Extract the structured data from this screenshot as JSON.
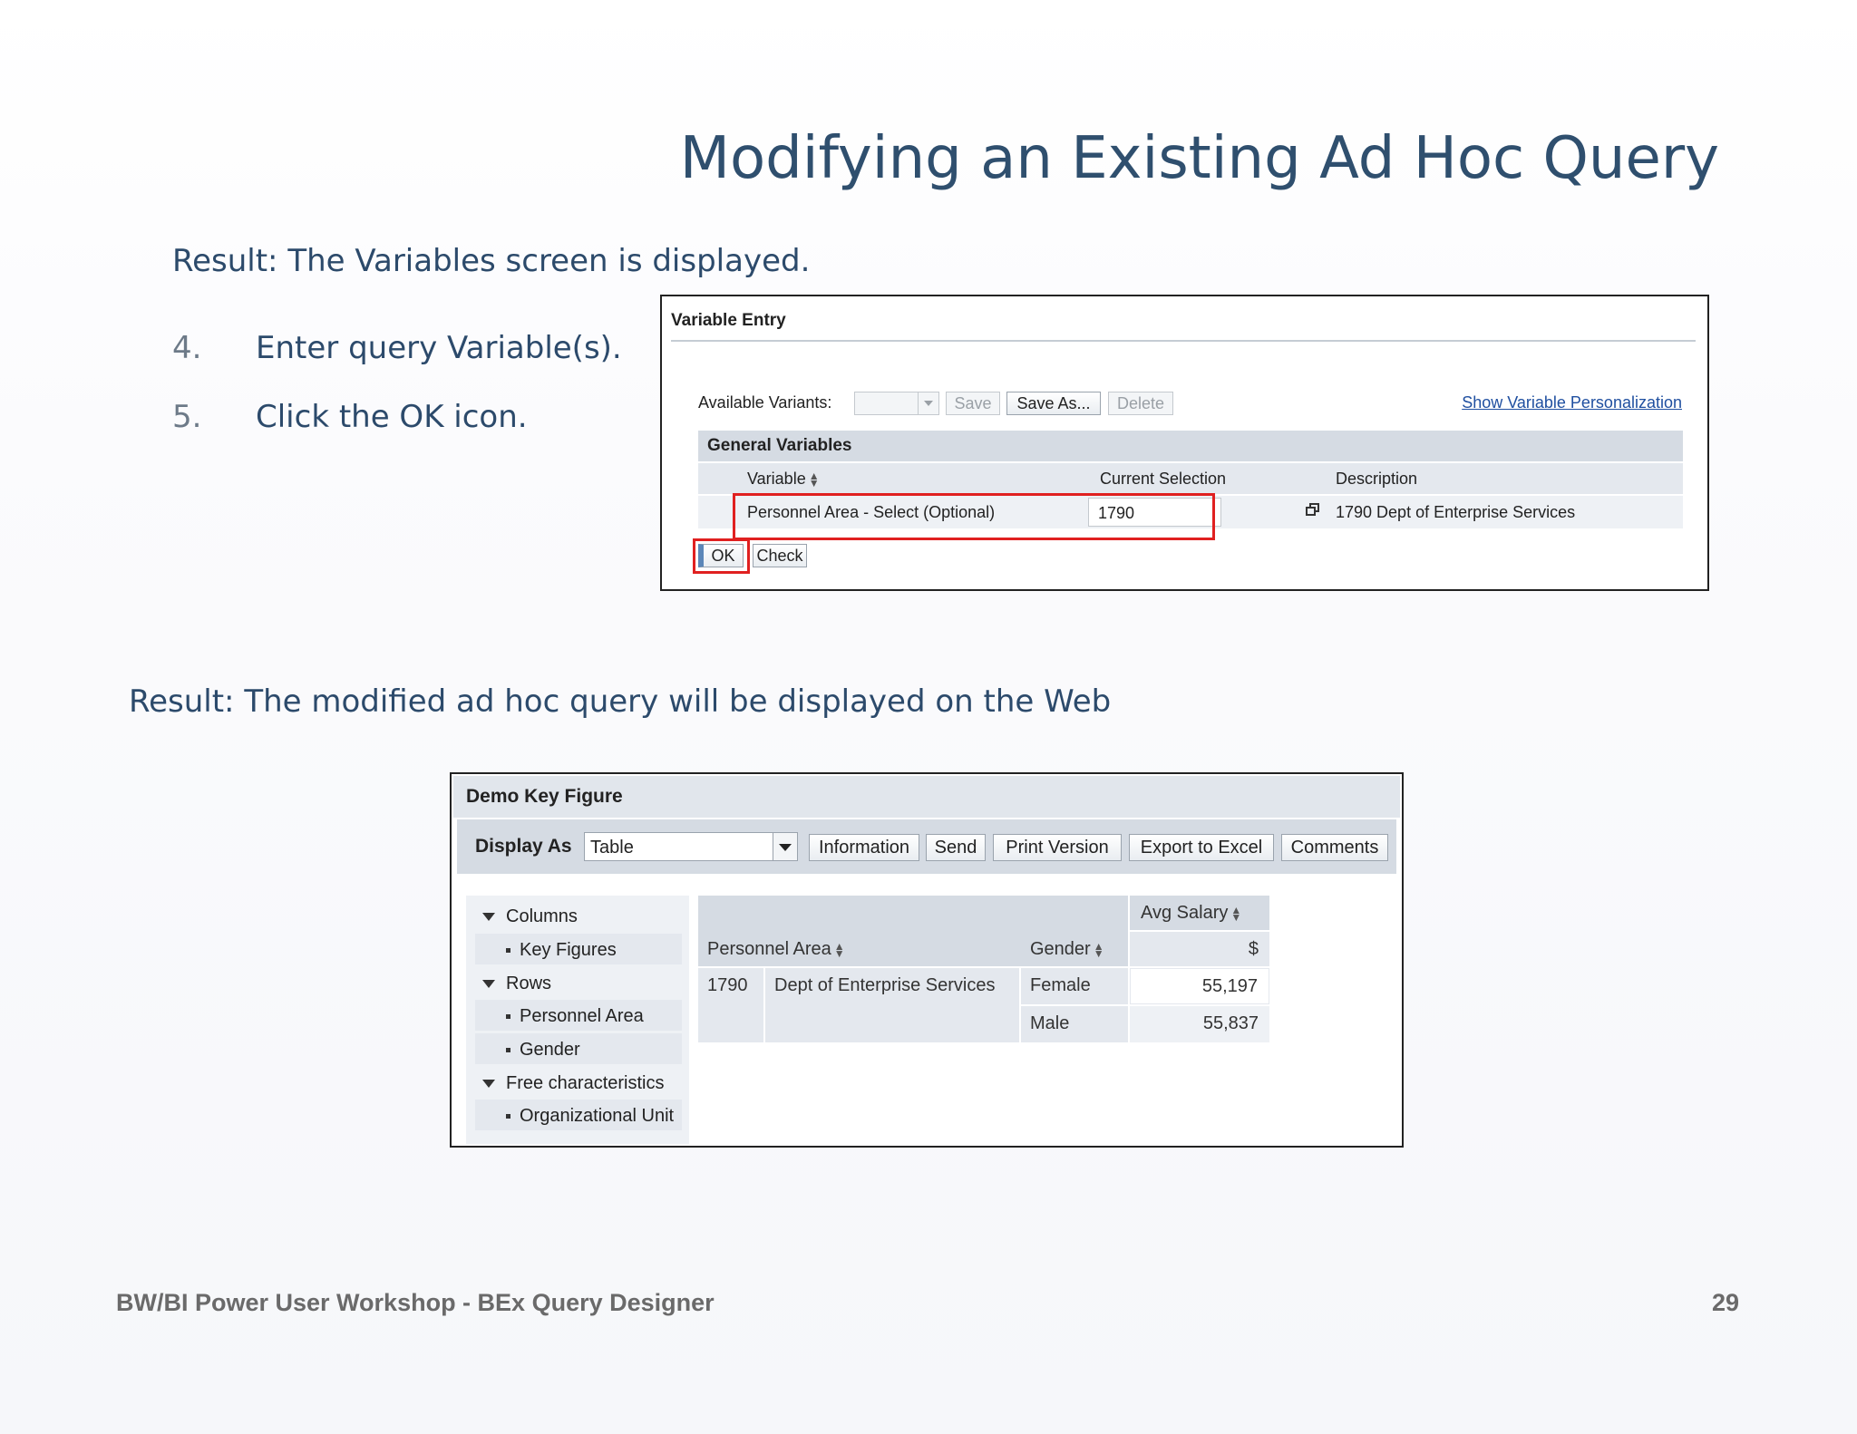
{
  "slide": {
    "title": "Modifying an Existing Ad Hoc Query",
    "result1": "Result:  The Variables screen is displayed.",
    "steps": [
      {
        "num": "4.",
        "text": "Enter query Variable(s)."
      },
      {
        "num": "5.",
        "text": "Click the OK icon."
      }
    ],
    "result2": "Result:  The modified ad hoc query will be displayed on the Web",
    "footer_left": "BW/BI Power User Workshop - BEx Query Designer",
    "page_number": "29"
  },
  "variable_entry": {
    "title": "Variable Entry",
    "available_variants_label": "Available Variants:",
    "buttons": {
      "save": "Save",
      "save_as": "Save As...",
      "delete": "Delete",
      "ok": "OK",
      "check": "Check"
    },
    "personalization_link": "Show Variable Personalization",
    "section_title": "General Variables",
    "columns": {
      "variable": "Variable",
      "current_selection": "Current Selection",
      "description": "Description"
    },
    "row": {
      "variable": "Personnel Area - Select (Optional)",
      "current_selection": "1790",
      "description": "1790 Dept of Enterprise Services"
    }
  },
  "report": {
    "title": "Demo Key Figure",
    "display_as_label": "Display As",
    "display_as_value": "Table",
    "buttons": [
      "Information",
      "Send",
      "Print Version",
      "Export to Excel",
      "Comments"
    ],
    "nav": {
      "columns": "Columns",
      "key_figures": "Key Figures",
      "rows": "Rows",
      "personnel_area": "Personnel Area",
      "gender": "Gender",
      "free_characteristics": "Free characteristics",
      "organizational_unit": "Organizational Unit"
    },
    "table": {
      "header_avg_salary": "Avg Salary",
      "header_personnel_area": "Personnel Area",
      "header_gender": "Gender",
      "unit": "$",
      "area_code": "1790",
      "area_name": "Dept of Enterprise Services",
      "rows": [
        {
          "gender": "Female",
          "value": "55,197"
        },
        {
          "gender": "Male",
          "value": "55,837"
        }
      ]
    }
  },
  "colors": {
    "title": "#2f4f6e",
    "highlight": "#e02020",
    "sap_header": "#d5dbe3",
    "sap_cell": "#e4e8ee"
  }
}
